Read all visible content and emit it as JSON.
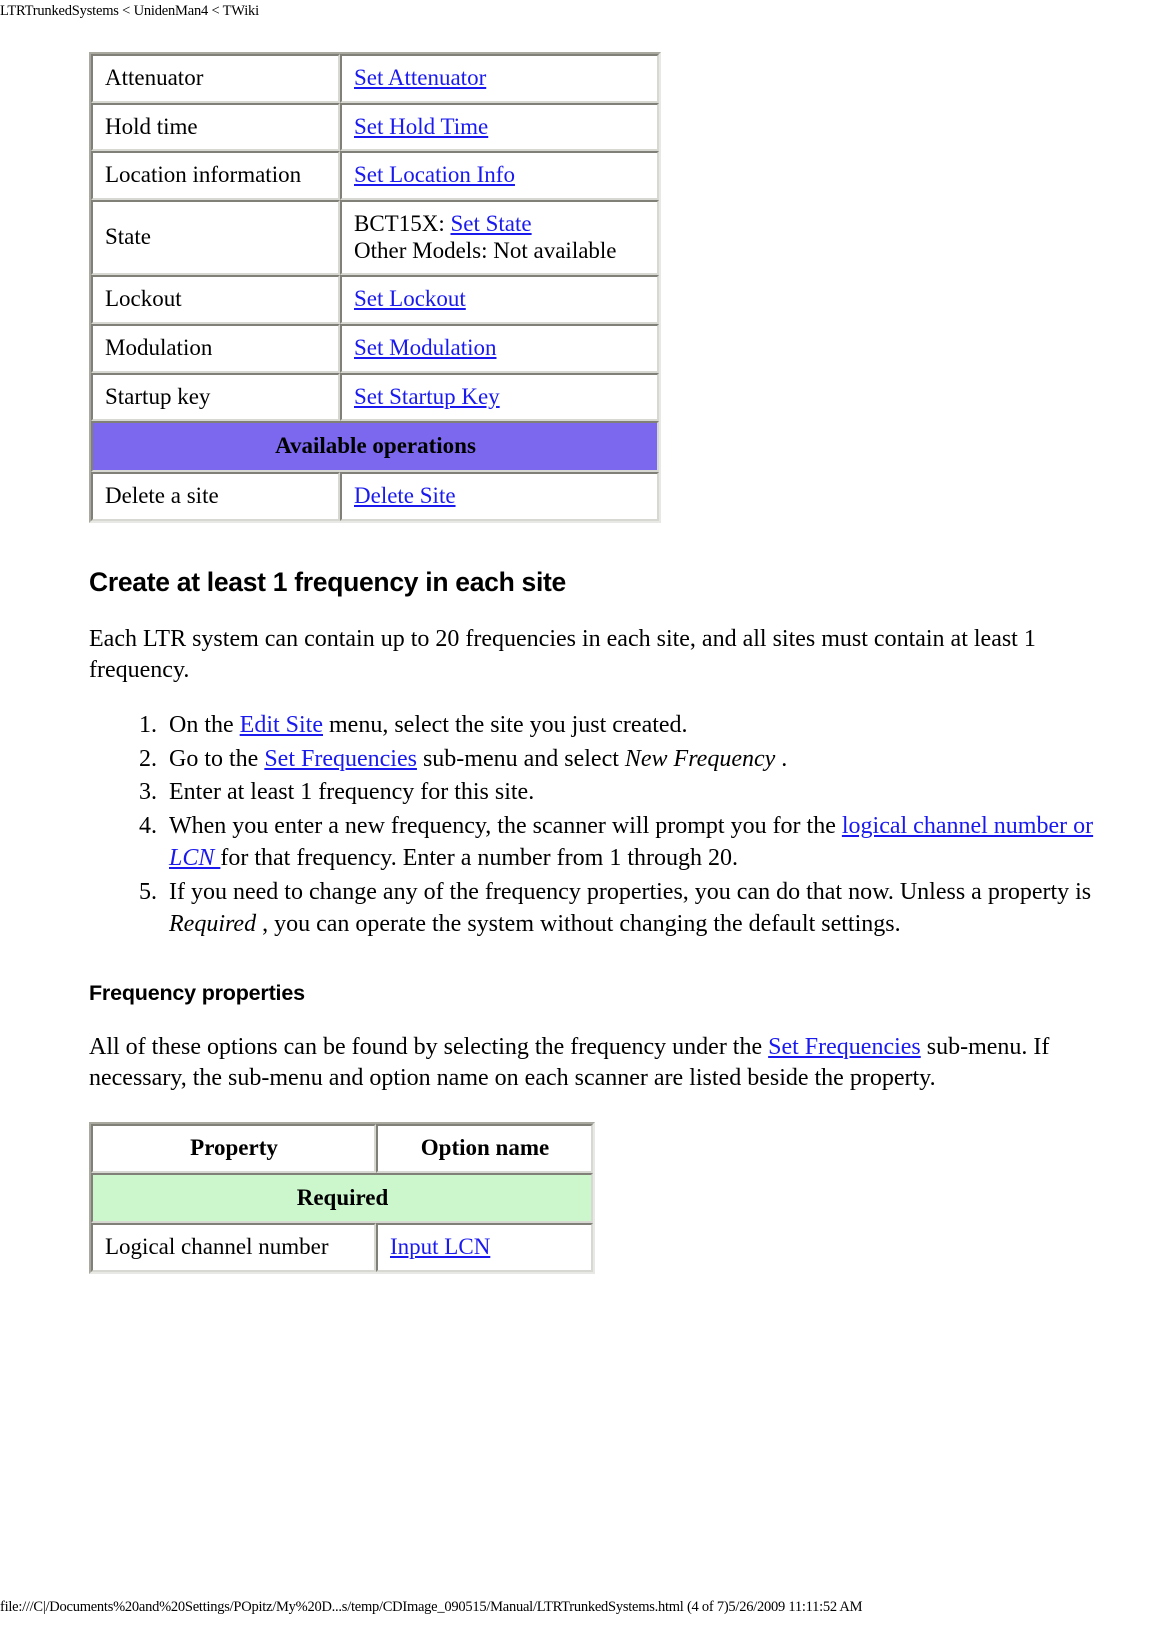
{
  "header": {
    "breadcrumb": "LTRTrunkedSystems < UnidenMan4 < TWiki"
  },
  "colors": {
    "link": "#1a1aee",
    "section_purple": "#7b68ee",
    "section_green": "#ccf7cc",
    "text": "#000000",
    "page_background": "#ffffff"
  },
  "site_table": {
    "rows": [
      {
        "property": "Attenuator",
        "option_link": "Set Attenuator"
      },
      {
        "property": "Hold time",
        "option_link": "Set Hold Time"
      },
      {
        "property": "Location information",
        "option_link": "Set Location Info"
      },
      {
        "property": "State",
        "option_prefix": "BCT15X: ",
        "option_link": "Set State",
        "option_second_line": "Other Models: Not available"
      },
      {
        "property": "Lockout",
        "option_link": "Set Lockout"
      },
      {
        "property": "Modulation",
        "option_link": "Set Modulation"
      },
      {
        "property": "Startup key",
        "option_link": "Set Startup Key"
      }
    ],
    "section_heading": "Available operations",
    "operation_row": {
      "property": "Delete a site",
      "option_link": "Delete Site"
    }
  },
  "create_frequency": {
    "heading": "Create at least 1 frequency in each site",
    "intro": "Each LTR system can contain up to 20 frequencies in each site, and all sites must contain at least 1 frequency.",
    "steps": [
      {
        "parts": [
          {
            "t": "text",
            "v": "On the "
          },
          {
            "t": "link",
            "v": "Edit Site"
          },
          {
            "t": "text",
            "v": " menu, select the site you just created."
          }
        ]
      },
      {
        "parts": [
          {
            "t": "text",
            "v": "Go to the "
          },
          {
            "t": "link",
            "v": "Set Frequencies"
          },
          {
            "t": "text",
            "v": " sub-menu and select "
          },
          {
            "t": "em",
            "v": "New Frequency"
          },
          {
            "t": "text",
            "v": " ."
          }
        ]
      },
      {
        "parts": [
          {
            "t": "text",
            "v": "Enter at least 1 frequency for this site."
          }
        ]
      },
      {
        "parts": [
          {
            "t": "text",
            "v": "When you enter a new frequency, the scanner will prompt you for the "
          },
          {
            "t": "link",
            "v": "logical channel number or "
          },
          {
            "t": "link-em",
            "v": "LCN "
          },
          {
            "t": "text",
            "v": "for that frequency. Enter a number from 1 through 20."
          }
        ]
      },
      {
        "parts": [
          {
            "t": "text",
            "v": "If you need to change any of the frequency properties, you can do that now. Unless a property is "
          },
          {
            "t": "em",
            "v": "Required"
          },
          {
            "t": "text",
            "v": " , you can operate the system without changing the default settings."
          }
        ]
      }
    ]
  },
  "frequency_properties": {
    "heading": "Frequency properties",
    "intro_parts": [
      {
        "t": "text",
        "v": "All of these options can be found by selecting the frequency under the "
      },
      {
        "t": "link",
        "v": "Set Frequencies"
      },
      {
        "t": "text",
        "v": " sub-menu. If necessary, the sub-menu and option name on each scanner are listed beside the property."
      }
    ],
    "table": {
      "headers": {
        "property": "Property",
        "option": "Option name"
      },
      "section_heading": "Required",
      "rows": [
        {
          "property": "Logical channel number",
          "option_link": "Input LCN"
        }
      ]
    }
  },
  "footer": {
    "path": "file:///C|/Documents%20and%20Settings/POpitz/My%20D...s/temp/CDImage_090515/Manual/LTRTrunkedSystems.html (4 of 7)5/26/2009 11:11:52 AM"
  }
}
